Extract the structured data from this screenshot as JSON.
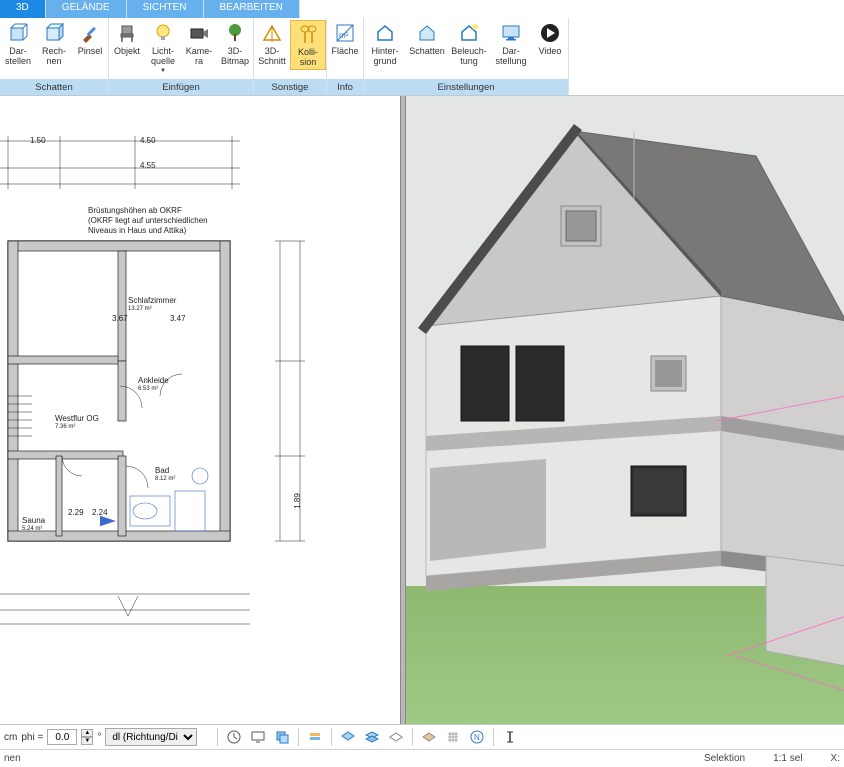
{
  "tabs": {
    "t0": "3D",
    "t1": "GELÄNDE",
    "t2": "SICHTEN",
    "t3": "BEARBEITEN"
  },
  "ribbon": {
    "groups": {
      "schatten": {
        "label": "Schatten"
      },
      "einfuegen": {
        "label": "Einfügen"
      },
      "sonstige": {
        "label": "Sonstige"
      },
      "info": {
        "label": "Info"
      },
      "einstellungen": {
        "label": "Einstellungen"
      }
    },
    "buttons": {
      "darstellen": "Dar-\nstellen",
      "rechnen": "Rech-\nnen",
      "pinsel": "Pinsel",
      "objekt": "Objekt",
      "lichtquelle": "Licht-\nquelle",
      "kamera": "Kame-\nra",
      "bitmap3d": "3D-\nBitmap",
      "schnitt3d": "3D-\nSchnitt",
      "kollision": "Kolli-\nsion",
      "flaeche": "Fläche",
      "hintergrund": "Hinter-\ngrund",
      "schatten2": "Schatten",
      "beleuchtung": "Beleuch-\ntung",
      "darstellung": "Dar-\nstellung",
      "video": "Video"
    }
  },
  "floorplan": {
    "note_title": "Brüstungshöhen ab OKRF",
    "note_line1": "(OKRF liegt auf unterschiedlichen",
    "note_line2": "Niveaus in Haus und Attika)",
    "rooms": {
      "schlafzimmer": "Schlafzimmer",
      "schlafzimmer_area": "13.27 m²",
      "ankleide": "Ankleide",
      "ankleide_area": "6.53 m²",
      "westflur": "Westflur OG",
      "westflur_area": "7.36 m²",
      "bad": "Bad",
      "bad_area": "8.12 m²",
      "sauna": "Sauna",
      "sauna_area": "5.24 m²"
    },
    "dims": {
      "d1": "1.50",
      "d2": "4.50",
      "d3": "4.55",
      "d4": "3.67",
      "d5": "3.47",
      "d6": "2.29",
      "d7": "2.24",
      "d8": "1.89"
    }
  },
  "bottombar": {
    "cm": "cm",
    "phi_label": "phi =",
    "phi_value": "0.0",
    "degree": "°",
    "dl_label": "dl (Richtung/Di"
  },
  "statusbar": {
    "left": "nen",
    "selektion": "Selektion",
    "ratio": "1:1 sel",
    "x": "X:"
  }
}
